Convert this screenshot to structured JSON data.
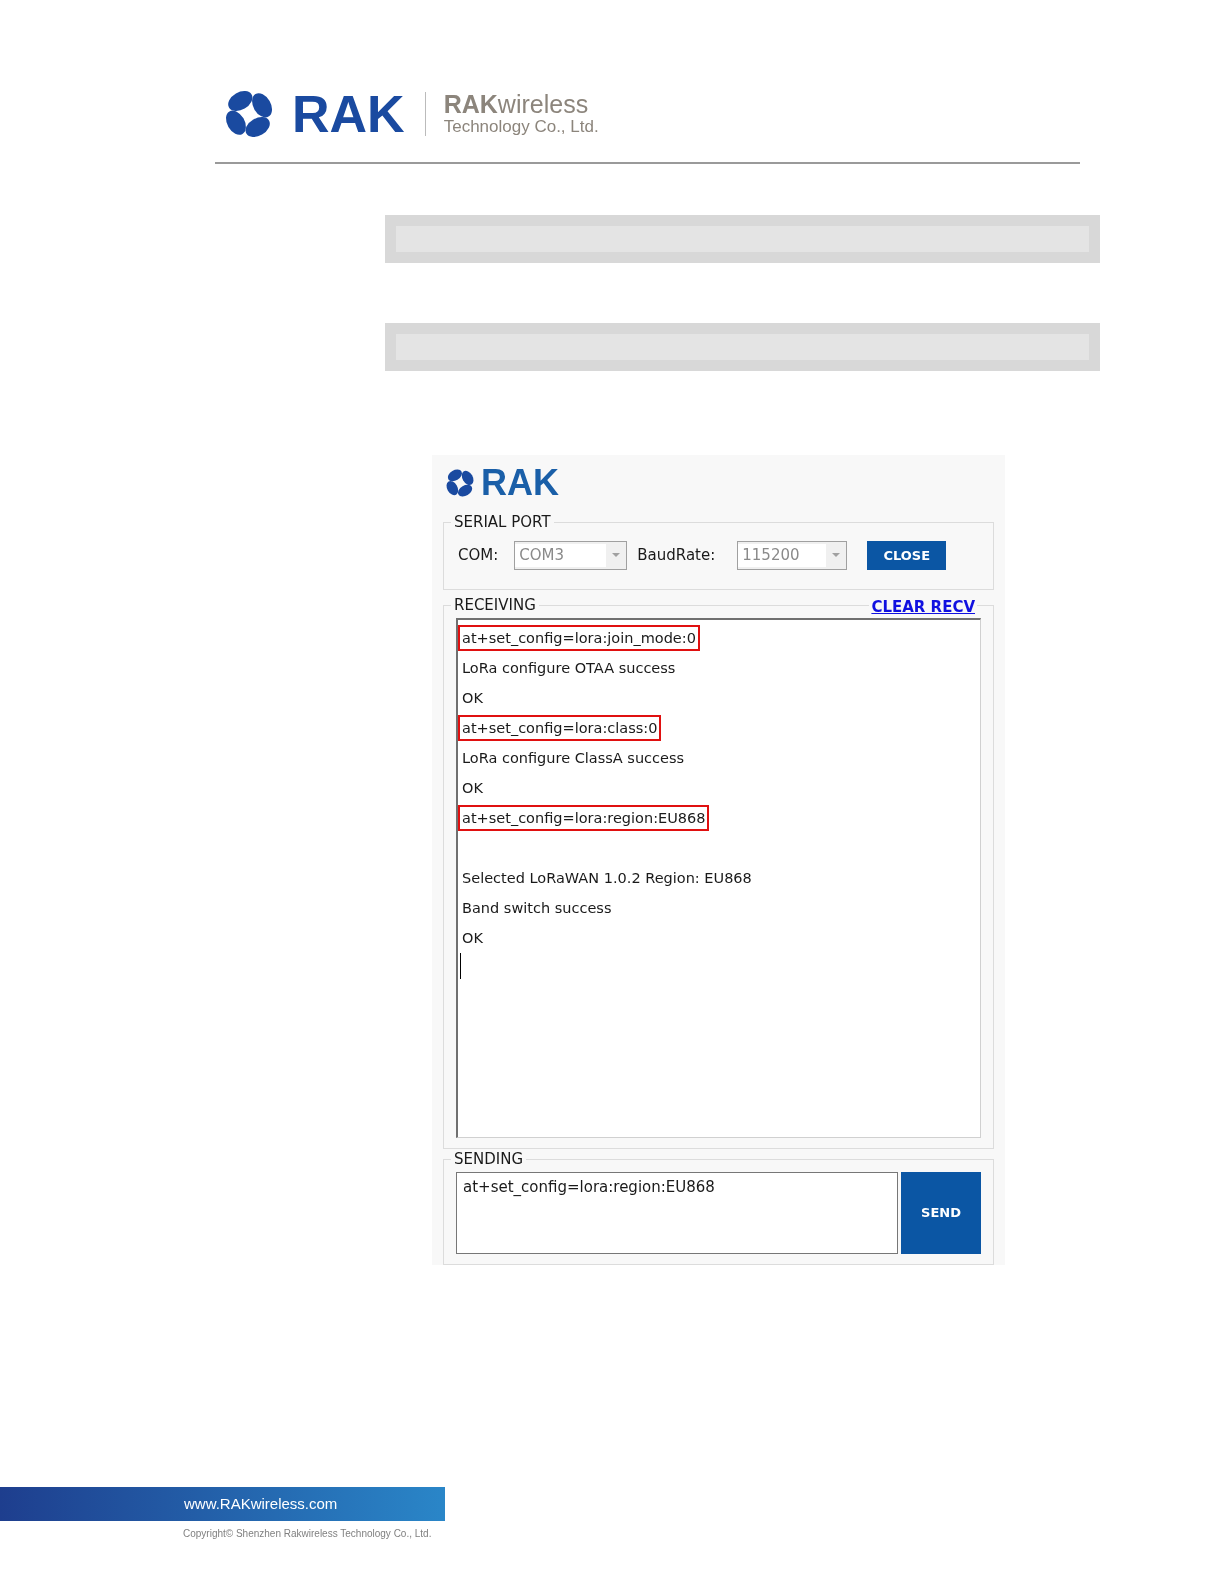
{
  "header": {
    "logo_text": "RAK",
    "company_name": "**RAK**wireless",
    "company_subtitle": "Technology Co., Ltd."
  },
  "app": {
    "logo_text": "RAK",
    "serial_port": {
      "title": "SERIAL PORT",
      "com_label": "COM:",
      "com": {
        "value": "COM3",
        "disabled": true
      },
      "baud_label": "BaudRate:",
      "baud": {
        "value": "115200",
        "disabled": true
      },
      "close_button": "CLOSE"
    },
    "receiving": {
      "title": "RECEIVING",
      "clear_link": "CLEAR RECV",
      "line_groups": [
        [
          {
            "text": "at+set_config=lora:join_mode:0",
            "highlighted": true
          },
          {
            "text": "LoRa configure OTAA success",
            "highlighted": false
          },
          {
            "text": "OK",
            "highlighted": false
          },
          {
            "text": "at+set_config=lora:class:0",
            "highlighted": true
          },
          {
            "text": "LoRa configure ClassA success",
            "highlighted": false
          },
          {
            "text": "OK",
            "highlighted": false
          },
          {
            "text": "at+set_config=lora:region:EU868",
            "highlighted": true
          }
        ],
        [
          {
            "text": "Selected LoRaWAN 1.0.2 Region: EU868",
            "highlighted": false
          },
          {
            "text": "Band switch success",
            "highlighted": false
          },
          {
            "text": "OK",
            "highlighted": false
          }
        ]
      ]
    },
    "sending": {
      "title": "SENDING",
      "value": "at+set_config=lora:region:EU868",
      "send_button": "SEND"
    }
  },
  "footer": {
    "url": "www.RAKwireless.com",
    "copyright": "Copyright© Shenzhen Rakwireless Technology Co., Ltd."
  }
}
